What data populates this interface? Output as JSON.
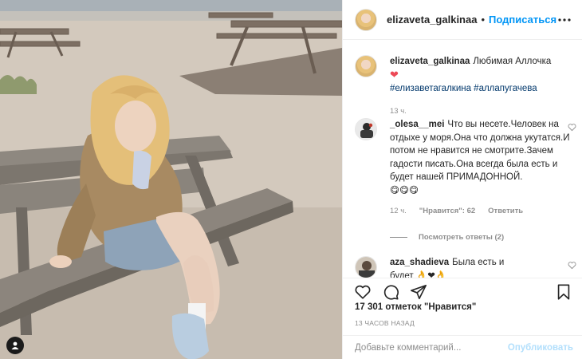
{
  "photo": {
    "alt_subject": "woman-sitting-on-beach-bench"
  },
  "header": {
    "username": "elizaveta_galkinaa",
    "separator": "•",
    "follow_label": "Подписаться",
    "more_icon": "ellipsis-icon"
  },
  "caption": {
    "username": "elizaveta_galkinaa",
    "text": "Любимая Аллочка",
    "emoji": "❤",
    "hashtags": "#елизаветагалкина #аллапугачева",
    "time": "13 ч."
  },
  "comments": [
    {
      "username": "_olesa__mei",
      "text": "Что вы несете.Человек на отдыхе у моря.Она что должна укутатся.И потом не нравится не смотрите.Зачем гадости писать.Она всегда была есть и будет нашей ПРИМАДОННОЙ.",
      "emojis": "😋😋😋",
      "time": "12 ч.",
      "likes": "\"Нравится\": 62",
      "reply_label": "Ответить",
      "view_replies": "Посмотреть ответы (2)"
    },
    {
      "username": "aza_shadieva",
      "text": "Была есть и",
      "text_cont": "будет 👌❤👌"
    }
  ],
  "actions": {
    "like_icon": "heart-icon",
    "comment_icon": "comment-icon",
    "share_icon": "paper-plane-icon",
    "save_icon": "bookmark-icon",
    "likes_count": "17 301 отметок \"Нравится\"",
    "time_ago": "13 ЧАСОВ НАЗАД"
  },
  "add_comment": {
    "placeholder": "Добавьте комментарий...",
    "publish_label": "Опубликовать"
  },
  "colors": {
    "link_blue": "#0095f6",
    "publish_disabled": "#b2dffc",
    "hashtag": "#00376b",
    "muted": "#8e8e8e",
    "heart_red": "#ed4956"
  }
}
